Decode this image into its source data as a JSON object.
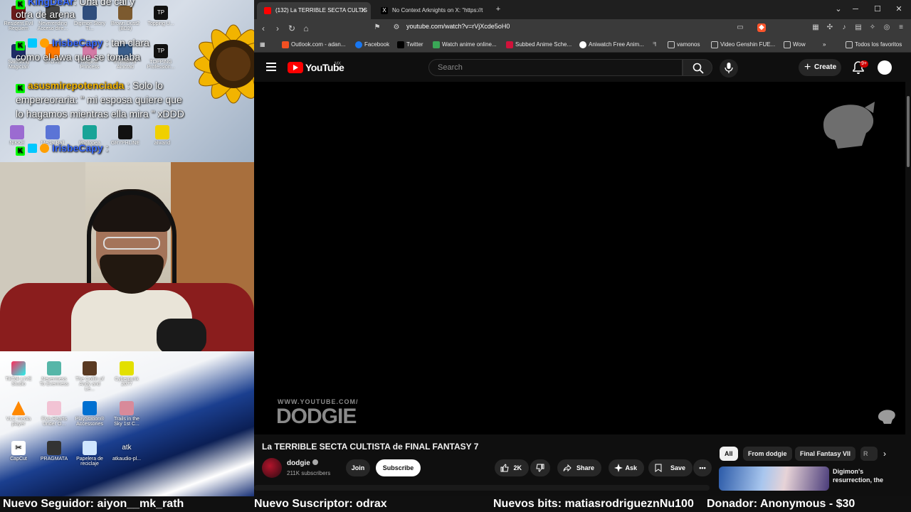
{
  "chat": {
    "messages": [
      {
        "user": "",
        "text": ": Una de cal y"
      },
      {
        "user": "",
        "text": "otra de arena"
      },
      {
        "user": "IrisbeCapy",
        "text": ": tan clara"
      },
      {
        "user": "",
        "text": "como el awa que se tomaba"
      },
      {
        "user": "asusmirepotenciada",
        "text": ": Solo lo"
      },
      {
        "user": "",
        "text": "empereoraria: \" mi esposa quiere que"
      },
      {
        "user": "",
        "text": "lo hagamos mientras ella mira \" xDDD"
      },
      {
        "user": "IrisbeCapy",
        "text": ":"
      }
    ],
    "colors": {
      "user_blue": "#3b6cff",
      "user_gold": "#f2b400"
    }
  },
  "desktop_icons_top": [
    {
      "label": "Resident Evil Requiem"
    },
    {
      "label": "Neverending Acceso dire..."
    },
    {
      "label": "Digimon Story Ti..."
    },
    {
      "label": "Brown Dust2 (BD2)"
    },
    {
      "label": "Topping U..."
    },
    {
      "label": "Samsung Magician"
    },
    {
      "label": "STOVE"
    },
    {
      "label": "Magical Princess"
    },
    {
      "label": "Echoes of Aincrad"
    },
    {
      "label": "TOPPING Profession..."
    },
    {
      "label": "NIKKE"
    },
    {
      "label": "Medal Ball"
    },
    {
      "label": "Photopea"
    },
    {
      "label": "GRYPHLINE"
    },
    {
      "label": "alwarid"
    }
  ],
  "desktop_icons_bottom": [
    {
      "label": "TikTok LIVE Studio"
    },
    {
      "label": "Nevermess To Evermess"
    },
    {
      "label": "The Coffin of Andy and Le..."
    },
    {
      "label": "Cyberpunk 2077"
    },
    {
      "label": "VLC media player"
    },
    {
      "label": "Five Hearts Under O..."
    },
    {
      "label": "PlayStation® Accessories"
    },
    {
      "label": "Trails in the Sky 1st C..."
    },
    {
      "label": "CapCut"
    },
    {
      "label": "PRAGMATA"
    },
    {
      "label": "Papelera de reciclaje"
    },
    {
      "label": "atkaudio-pl..."
    }
  ],
  "browser": {
    "tabs": [
      {
        "label": "(132) La TERRIBLE SECTA CULTIS",
        "active": true
      },
      {
        "label": "No Context Arknights on X: \"https://t",
        "active": false
      }
    ],
    "new_tab": "+",
    "url": "youtube.com/watch?v=rVjXcde5oH0",
    "bookmarks": [
      {
        "label": "Outlook.com - adan..."
      },
      {
        "label": "Facebook"
      },
      {
        "label": "Twitter"
      },
      {
        "label": "Watch anime online..."
      },
      {
        "label": "Subbed Anime Sche..."
      },
      {
        "label": "Aniwatch Free Anim..."
      },
      {
        "label": "vamonos"
      },
      {
        "label": "Video Genshin FUE..."
      },
      {
        "label": "Wow"
      },
      {
        "label": "Todos los favoritos"
      }
    ]
  },
  "youtube": {
    "logo": "YouTube",
    "country": "MX",
    "search_placeholder": "Search",
    "create": "Create",
    "notif_count": "9+",
    "video": {
      "watermark_small": "WWW.YOUTUBE.COM/",
      "watermark_big": "DODGIE",
      "title": "La TERRIBLE SECTA CULTISTA de FINAL FANTASY 7"
    },
    "channel": {
      "name": "dodgie",
      "subs": "211K subscribers",
      "join": "Join",
      "subscribe": "Subscribe"
    },
    "actions": {
      "likes": "2K",
      "share": "Share",
      "ask": "Ask",
      "save": "Save"
    },
    "chips": [
      {
        "label": "All",
        "active": true
      },
      {
        "label": "From dodgie",
        "active": false
      },
      {
        "label": "Final Fantasy VII",
        "active": false
      },
      {
        "label": "R",
        "active": false
      }
    ],
    "recommended": {
      "title": "Digimon's resurrection, the"
    }
  },
  "ticker": {
    "follower": "Nuevo Seguidor: aiyon__mk_rath",
    "subscriber": "Nuevo Suscriptor: odrax",
    "bits": "Nuevos bits: matiasrodrigueznNu100",
    "donor": "Donador: Anonymous - $30"
  }
}
